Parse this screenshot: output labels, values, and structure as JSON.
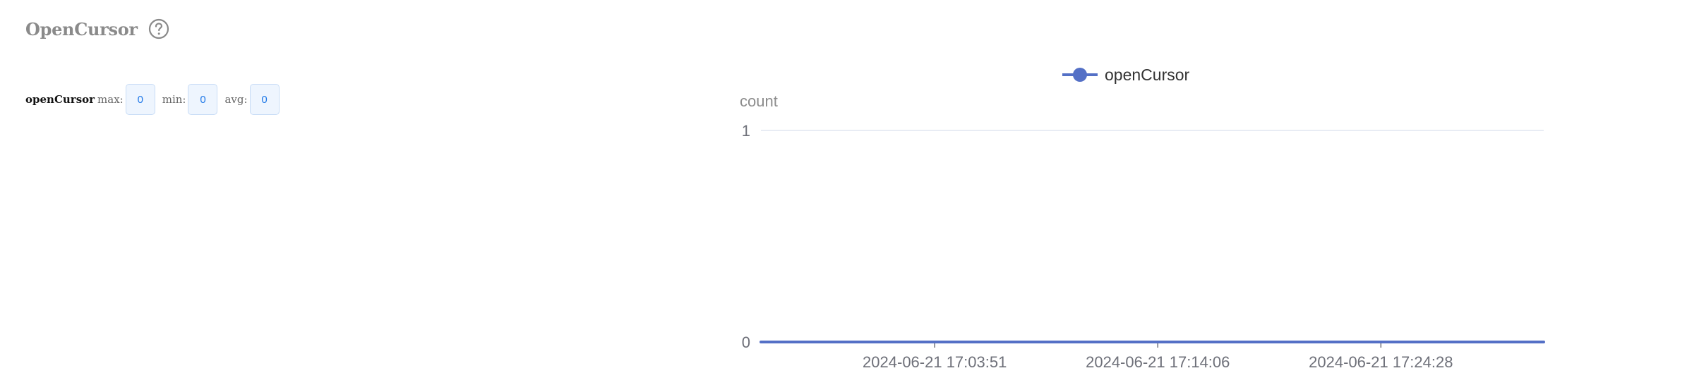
{
  "panel": {
    "title": "OpenCursor",
    "help_icon": "question-circle-icon"
  },
  "stats": {
    "metric": "openCursor",
    "max_label": "max:",
    "max_value": "0",
    "min_label": "min:",
    "min_value": "0",
    "avg_label": "avg:",
    "avg_value": "0"
  },
  "colors": {
    "series": "#5470c6",
    "grid": "#e0e6f1",
    "axis_text": "#6e7079",
    "title": "#8a8a8a",
    "stat_value": "#1f78e8"
  },
  "chart_data": {
    "type": "line",
    "title": "",
    "ylabel": "count",
    "xlabel": "",
    "ylim": [
      0,
      1
    ],
    "yticks": [
      0,
      1
    ],
    "grid": true,
    "legend_position": "top-center",
    "x_tick_labels": [
      "2024-06-21 17:03:51",
      "2024-06-21 17:14:06",
      "2024-06-21 17:24:28"
    ],
    "x_tick_positions": [
      0.222,
      0.507,
      0.792
    ],
    "series": [
      {
        "name": "openCursor",
        "color": "#5470c6",
        "x": [
          0,
          1
        ],
        "values": [
          0,
          0
        ]
      }
    ]
  }
}
